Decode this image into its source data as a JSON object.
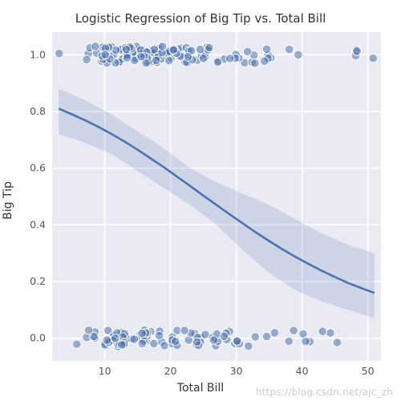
{
  "chart_data": {
    "type": "scatter_with_regression",
    "title": "Logistic Regression of Big Tip vs. Total Bill",
    "xlabel": "Total Bill",
    "ylabel": "Big Tip",
    "xlim": [
      2,
      52
    ],
    "ylim": [
      -0.08,
      1.08
    ],
    "xticks": [
      10,
      20,
      30,
      40,
      50
    ],
    "yticks": [
      0.0,
      0.2,
      0.4,
      0.6,
      0.8,
      1.0
    ],
    "xtick_labels": [
      "10",
      "20",
      "30",
      "40",
      "50"
    ],
    "ytick_labels": [
      "0.0",
      "0.2",
      "0.4",
      "0.6",
      "0.8",
      "1.0"
    ],
    "scatter": {
      "x": [
        16.99,
        10.34,
        21.01,
        23.68,
        24.59,
        25.29,
        8.77,
        26.88,
        15.04,
        14.78,
        10.27,
        35.26,
        15.42,
        18.43,
        14.83,
        21.58,
        10.33,
        16.29,
        16.97,
        20.65,
        17.92,
        20.29,
        15.77,
        39.42,
        19.82,
        17.81,
        13.37,
        12.69,
        21.7,
        19.65,
        9.55,
        18.35,
        15.06,
        20.69,
        17.78,
        24.06,
        16.31,
        16.93,
        18.69,
        31.27,
        16.04,
        17.46,
        13.94,
        9.68,
        30.4,
        18.29,
        22.23,
        32.4,
        28.55,
        18.04,
        12.54,
        10.29,
        34.81,
        9.94,
        25.56,
        19.49,
        38.01,
        26.41,
        11.24,
        48.27,
        20.29,
        13.81,
        11.02,
        18.29,
        17.59,
        20.08,
        16.45,
        3.07,
        20.23,
        15.01,
        12.02,
        17.07,
        26.86,
        25.28,
        14.73,
        10.51,
        17.92,
        27.2,
        22.76,
        17.29,
        19.44,
        16.66,
        10.07,
        32.68,
        15.98,
        34.83,
        13.03,
        18.28,
        24.71,
        21.16,
        28.97,
        22.49,
        5.75,
        16.32,
        22.75,
        40.17,
        27.28,
        12.03,
        21.01,
        12.46,
        11.35,
        15.38,
        44.3,
        22.42,
        20.92,
        15.36,
        20.49,
        25.21,
        18.24,
        14.31,
        14.0,
        7.25,
        38.07,
        23.95,
        25.71,
        17.31,
        29.93,
        10.65,
        12.43,
        24.08,
        11.69,
        13.42,
        14.26,
        15.95,
        12.48,
        29.8,
        8.52,
        14.52,
        11.38,
        22.82,
        19.08,
        20.27,
        11.17,
        12.26,
        18.26,
        8.51,
        10.33,
        14.15,
        16.0,
        13.16,
        17.47,
        34.3,
        41.19,
        27.05,
        16.43,
        8.35,
        18.64,
        11.87,
        9.78,
        7.51,
        14.07,
        13.13,
        17.26,
        24.55,
        19.77,
        29.85,
        48.17,
        25.0,
        13.39,
        16.49,
        21.5,
        12.66,
        16.21,
        13.81,
        17.51,
        24.52,
        20.76,
        31.71,
        10.59,
        10.63,
        50.81,
        15.81,
        7.25,
        31.85,
        16.82,
        32.9,
        17.89,
        14.48,
        9.6,
        34.63,
        34.65,
        23.33,
        45.35,
        23.17,
        40.55,
        20.69,
        20.9,
        30.46,
        18.15,
        23.1,
        15.69,
        19.81,
        28.44,
        15.48,
        16.58,
        7.56,
        10.34,
        43.11,
        13.0,
        13.51,
        18.71,
        12.74,
        13.0,
        16.4,
        20.53,
        16.47,
        26.59,
        38.73,
        24.27,
        12.76,
        30.06,
        25.89,
        48.33,
        13.27,
        28.17,
        12.9,
        28.15,
        11.59,
        7.74,
        30.14,
        12.16,
        13.42,
        8.58,
        15.98,
        13.42,
        16.27,
        10.09,
        20.45,
        13.28,
        22.12,
        24.01,
        15.69,
        11.61,
        10.77,
        15.53,
        10.07,
        12.6,
        32.83,
        35.83,
        29.03,
        27.18,
        22.67,
        17.82,
        18.78
      ],
      "y": [
        0,
        1,
        0,
        0,
        0,
        0,
        1,
        0,
        1,
        1,
        1,
        1,
        0,
        1,
        1,
        1,
        1,
        1,
        1,
        1,
        1,
        0,
        1,
        1,
        1,
        1,
        0,
        0,
        1,
        1,
        1,
        0,
        1,
        0,
        1,
        1,
        0,
        1,
        0,
        1,
        0,
        0,
        1,
        1,
        1,
        0,
        1,
        1,
        0,
        1,
        1,
        1,
        1,
        0,
        1,
        1,
        0,
        0,
        0,
        1,
        0,
        1,
        1,
        1,
        1,
        1,
        0,
        1,
        0,
        1,
        0,
        1,
        0,
        1,
        1,
        0,
        1,
        0,
        0,
        1,
        1,
        1,
        0,
        1,
        1,
        1,
        1,
        1,
        1,
        1,
        0,
        1,
        0,
        1,
        1,
        0,
        1,
        0,
        0,
        0,
        1,
        1,
        0,
        1,
        1,
        0,
        1,
        1,
        1,
        1,
        1,
        0,
        1,
        0,
        1,
        1,
        1,
        0,
        1,
        0,
        1,
        0,
        1,
        0,
        1,
        0,
        0,
        1,
        0,
        1,
        0,
        0,
        0,
        0,
        1,
        0,
        1,
        0,
        0,
        1,
        1,
        1,
        0,
        0,
        1,
        0,
        1,
        0,
        1,
        1,
        1,
        0,
        1,
        0,
        1,
        1,
        1,
        1,
        1,
        0,
        1,
        1,
        0,
        1,
        1,
        1,
        0,
        1,
        0,
        1,
        1,
        1,
        1,
        0,
        1,
        0,
        1,
        0,
        1,
        0,
        1,
        1,
        0,
        1,
        0,
        1,
        1,
        0,
        1,
        0,
        0,
        1,
        0,
        1,
        1,
        0,
        0,
        0,
        0,
        1,
        1,
        0,
        0,
        1,
        1,
        1,
        0,
        0,
        0,
        1,
        0,
        1,
        1,
        1,
        1,
        0,
        0,
        0,
        1,
        0,
        1,
        1,
        1,
        1,
        1,
        1,
        1,
        1,
        1,
        0,
        0,
        0,
        1,
        1,
        1,
        1,
        0,
        1,
        0,
        1,
        1,
        1,
        1,
        1
      ],
      "jitter_amplitude": 0.03
    },
    "regression_curve": {
      "x": [
        3,
        5,
        7,
        9,
        11,
        13,
        15,
        17,
        19,
        21,
        23,
        25,
        27,
        29,
        31,
        33,
        35,
        37,
        39,
        41,
        43,
        45,
        47,
        49,
        51
      ],
      "y": [
        0.81,
        0.79,
        0.769,
        0.746,
        0.721,
        0.694,
        0.665,
        0.634,
        0.603,
        0.57,
        0.537,
        0.503,
        0.47,
        0.437,
        0.405,
        0.373,
        0.343,
        0.314,
        0.287,
        0.262,
        0.238,
        0.216,
        0.195,
        0.177,
        0.16
      ]
    },
    "confidence_band": {
      "x": [
        3,
        7,
        11,
        15,
        19,
        23,
        27,
        31,
        35,
        39,
        43,
        47,
        51
      ],
      "upper": [
        0.88,
        0.84,
        0.79,
        0.73,
        0.67,
        0.6,
        0.55,
        0.51,
        0.47,
        0.42,
        0.37,
        0.33,
        0.3
      ],
      "lower": [
        0.72,
        0.69,
        0.65,
        0.59,
        0.53,
        0.47,
        0.4,
        0.31,
        0.23,
        0.17,
        0.13,
        0.1,
        0.07
      ]
    },
    "colors": {
      "dot_fill": "#4c72b0",
      "dot_face_alpha": 0.55,
      "dot_edge": "#ffffff",
      "line": "#4c72b0",
      "band": "#4c72b0",
      "band_alpha": 0.18
    }
  },
  "watermark": "https://blog.csdn.net/ajc_zh"
}
